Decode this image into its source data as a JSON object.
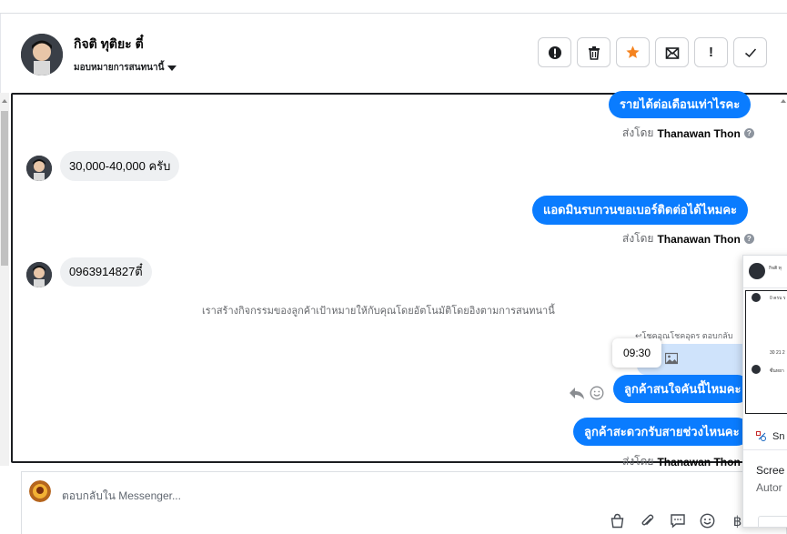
{
  "header": {
    "contact_name": "กิจติ ทุติยะ ตี๋",
    "assign_label": "มอบหมายการสนทนานี้"
  },
  "toolbar": {
    "buttons": [
      {
        "name": "spam-button",
        "icon": "alert-circle-icon"
      },
      {
        "name": "delete-button",
        "icon": "trash-icon"
      },
      {
        "name": "follow-up-button",
        "icon": "star-icon",
        "color": "#f5831f"
      },
      {
        "name": "mark-unread-button",
        "icon": "envelope-icon"
      },
      {
        "name": "priority-button",
        "icon": "exclamation-icon",
        "label": "!"
      },
      {
        "name": "done-button",
        "icon": "check-icon"
      }
    ]
  },
  "messages": {
    "m1": "รายได้ต่อเดือนเท่าไรคะ",
    "m1_sent_prefix": "ส่งโดย",
    "m1_sent_name": "Thanawan Thon",
    "m2": "30,000-40,000 ครับ",
    "m3": "แอดมินรบกวนขอเบอร์ติดต่อได้ไหมคะ",
    "m3_sent_prefix": "ส่งโดย",
    "m3_sent_name": "Thanawan Thon",
    "m4": "0963914827ตี๋",
    "system_note": "เราสร้างกิจกรรมของลูกค้าเป้าหมายให้กับคุณโดยอัตโนมัติโดยอิงตามการสนทนานี้",
    "reply_ref": "↩โชคอุณโชคอุดร ตอบกลับ",
    "tooltip_time": "09:30",
    "m5": "ลูกค้าสนใจคันนี้ไหมคะ",
    "m6": "ลูกค้าสะดวกรับสายช่วงไหนคะ",
    "m6_sent_prefix": "ส่งโดย",
    "m6_sent_name": "Thanawan Thon"
  },
  "composer": {
    "placeholder": "ตอบกลับใน Messenger...",
    "icons": [
      "bag-icon",
      "paperclip-icon",
      "saved-reply-icon",
      "emoji-icon",
      "baht-icon"
    ],
    "baht_glyph": "฿"
  },
  "popup": {
    "snip_label": "Sn",
    "line1": "Scree",
    "line2": "Autor",
    "mini_title": "กิจติ ทุ",
    "mini_l1": "0 ครบ ร",
    "mini_l2": "30 21 2",
    "mini_l3": "ซึ่นหยา"
  },
  "colors": {
    "outgoing_bubble": "#0a7cff",
    "incoming_bubble": "#eef0f2",
    "star": "#f5831f"
  }
}
